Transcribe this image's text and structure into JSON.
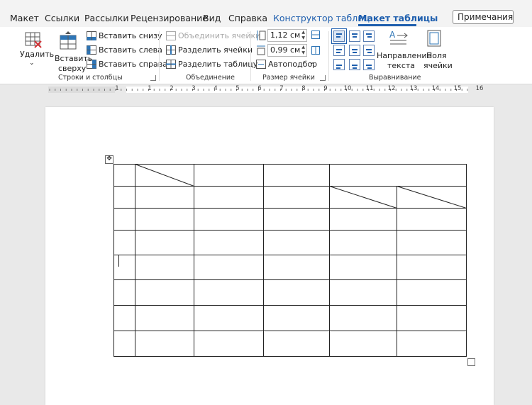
{
  "tabs": [
    {
      "label": "Макет"
    },
    {
      "label": "Ссылки"
    },
    {
      "label": "Рассылки"
    },
    {
      "label": "Рецензирование"
    },
    {
      "label": "Вид"
    },
    {
      "label": "Справка"
    },
    {
      "label": "Конструктор таблиц"
    },
    {
      "label": "Макет таблицы"
    }
  ],
  "active_tab": "Макет таблицы",
  "comments_button": "Примечания",
  "rows_cols": {
    "delete": "Удалить",
    "insert_above_line1": "Вставить",
    "insert_above_line2": "сверху",
    "insert_below": "Вставить снизу",
    "insert_left": "Вставить слева",
    "insert_right": "Вставить справа",
    "group": "Строки и столбцы"
  },
  "merge": {
    "merge_cells": "Объединить ячейки",
    "split_cells": "Разделить ячейки",
    "split_table": "Разделить таблицу",
    "group": "Объединение"
  },
  "cell_size": {
    "height": "1,12 см",
    "width": "0,99 см",
    "autofit": "Автоподбор",
    "group": "Размер ячейки"
  },
  "alignment": {
    "text_direction_line1": "Направление",
    "text_direction_line2": "текста",
    "cell_margins_line1": "Поля",
    "cell_margins_line2": "ячейки",
    "group": "Выравнивание"
  },
  "ruler_numbers": [
    "1",
    "1",
    "2",
    "3",
    "4",
    "5",
    "6",
    "7",
    "8",
    "9",
    "10",
    "11",
    "12",
    "13",
    "14",
    "15",
    "16"
  ],
  "colors": {
    "accent": "#1f5fae",
    "ribbon": "#ffffff",
    "tabbar": "#f3f3f3",
    "workspace": "#e9e9e9"
  }
}
